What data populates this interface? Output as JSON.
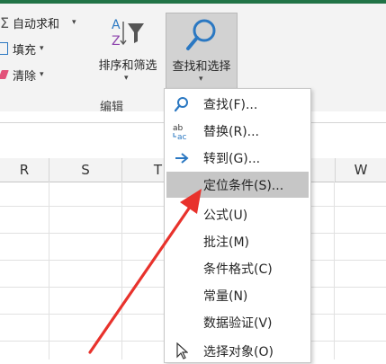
{
  "ribbon": {
    "autosum_label": "自动求和",
    "fill_label": "填充",
    "clear_label": "清除",
    "sort_filter_label": "排序和筛选",
    "find_select_label": "查找和选择",
    "group_label": "编辑",
    "dropdown_glyph": "▾"
  },
  "columns": [
    "R",
    "S",
    "T",
    "W"
  ],
  "menu": {
    "items": [
      {
        "label": "查找(F)...",
        "icon": "search-icon"
      },
      {
        "label": "替换(R)...",
        "icon": "replace-icon"
      },
      {
        "label": "转到(G)...",
        "icon": "goto-arrow-icon"
      },
      {
        "label": "定位条件(S)...",
        "icon": "",
        "highlighted": true
      },
      {
        "label": "公式(U)",
        "icon": ""
      },
      {
        "label": "批注(M)",
        "icon": ""
      },
      {
        "label": "条件格式(C)",
        "icon": ""
      },
      {
        "label": "常量(N)",
        "icon": ""
      },
      {
        "label": "数据验证(V)",
        "icon": ""
      },
      {
        "label": "选择对象(O)",
        "icon": "select-objects-icon"
      }
    ]
  },
  "colors": {
    "accent": "#217346",
    "highlight": "#c6c6c6",
    "icon_blue": "#2b78c2",
    "annotation_red": "#e8322c"
  }
}
